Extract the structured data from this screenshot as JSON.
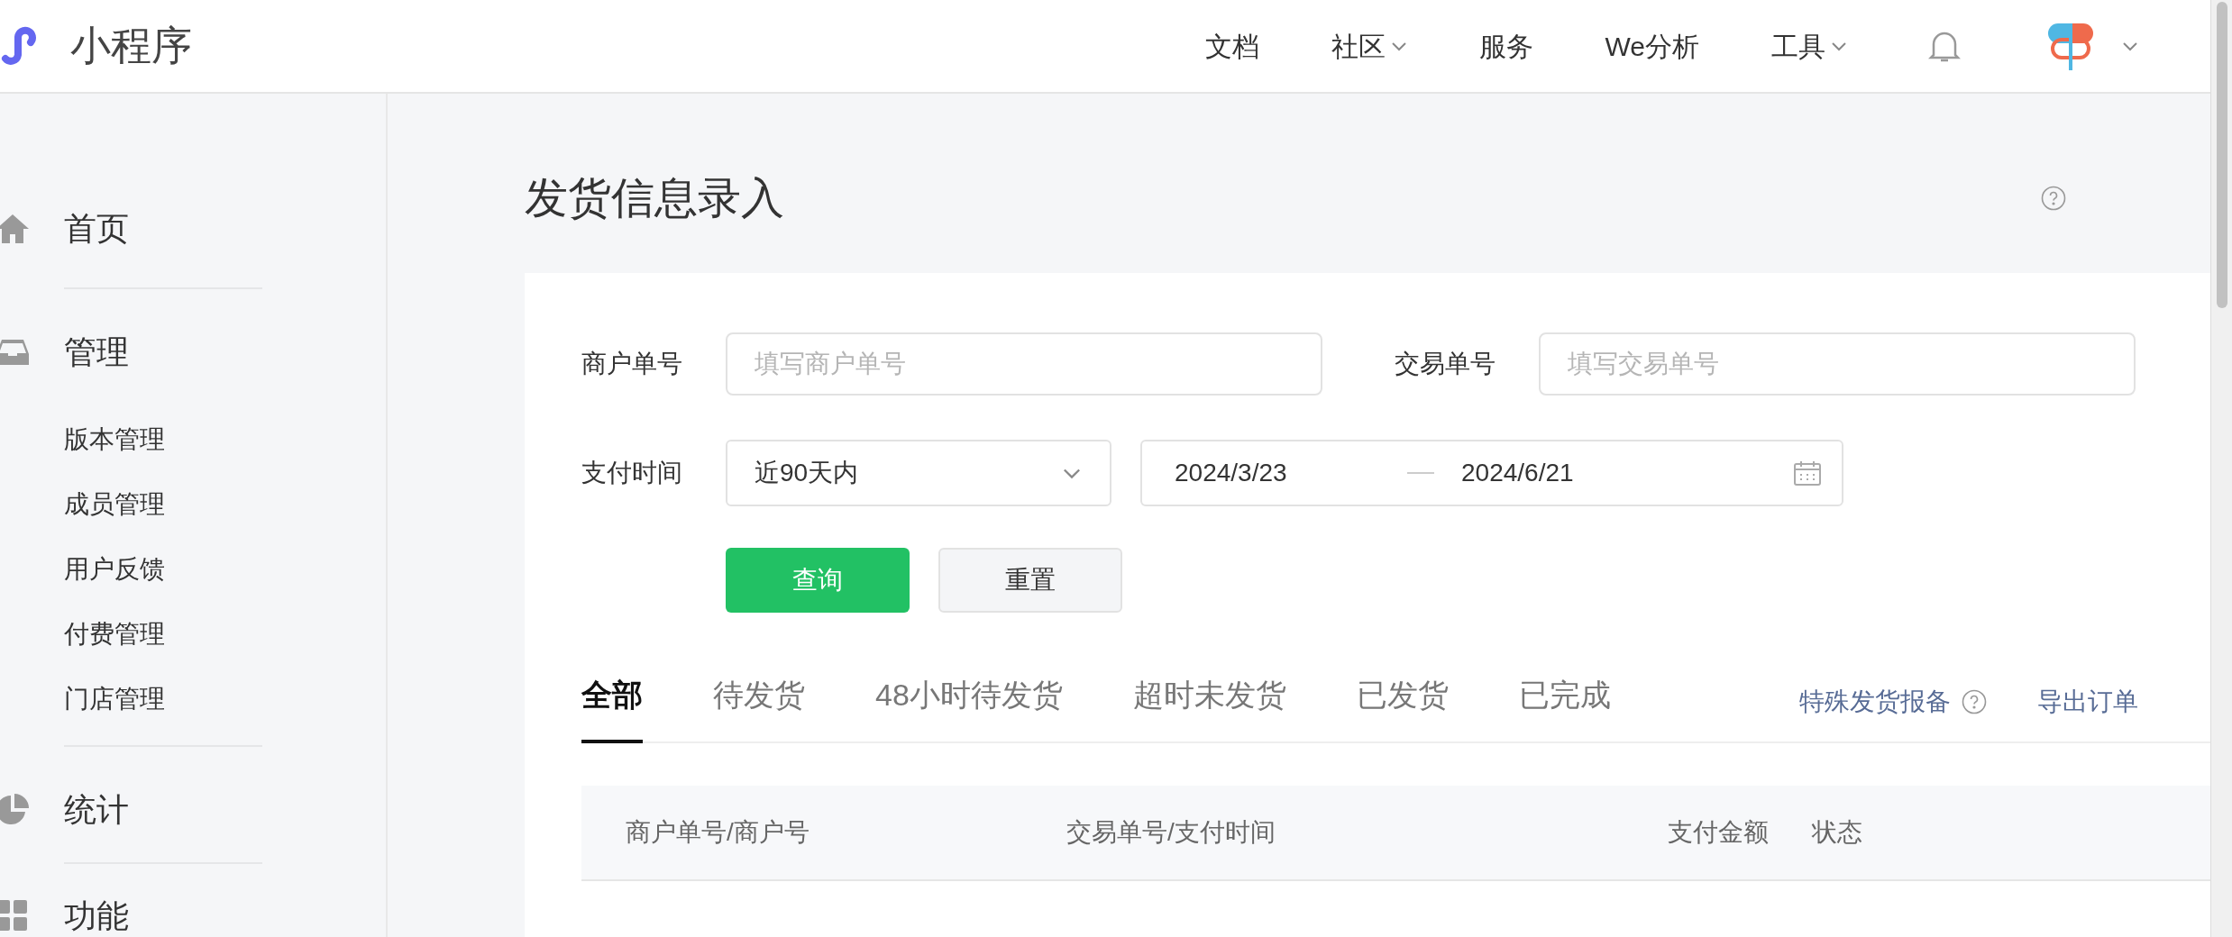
{
  "header": {
    "logo_text": "小程序",
    "nav": [
      {
        "label": "文档",
        "dropdown": false
      },
      {
        "label": "社区",
        "dropdown": true
      },
      {
        "label": "服务",
        "dropdown": false
      },
      {
        "label": "We分析",
        "dropdown": false
      },
      {
        "label": "工具",
        "dropdown": true
      }
    ]
  },
  "sidebar": {
    "groups": [
      {
        "label": "首页"
      },
      {
        "label": "管理",
        "children": [
          {
            "label": "版本管理"
          },
          {
            "label": "成员管理"
          },
          {
            "label": "用户反馈"
          },
          {
            "label": "付费管理"
          },
          {
            "label": "门店管理"
          }
        ]
      },
      {
        "label": "统计"
      },
      {
        "label": "功能"
      }
    ]
  },
  "page": {
    "title": "发货信息录入"
  },
  "filters": {
    "merchant_no": {
      "label": "商户单号",
      "placeholder": "填写商户单号"
    },
    "trade_no": {
      "label": "交易单号",
      "placeholder": "填写交易单号"
    },
    "pay_time": {
      "label": "支付时间",
      "range": "近90天内",
      "start": "2024/3/23",
      "end": "2024/6/21"
    },
    "buttons": [
      {
        "label": "查询",
        "kind": "primary"
      },
      {
        "label": "重置",
        "kind": "default"
      }
    ]
  },
  "tabs": [
    {
      "label": "全部",
      "selected": true
    },
    {
      "label": "待发货",
      "selected": false
    },
    {
      "label": "48小时待发货",
      "selected": false
    },
    {
      "label": "超时未发货",
      "selected": false
    },
    {
      "label": "已发货",
      "selected": false
    },
    {
      "label": "已完成",
      "selected": false
    }
  ],
  "links": [
    {
      "label": "特殊发货报备",
      "help": true
    },
    {
      "label": "导出订单",
      "help": false
    }
  ],
  "table": {
    "columns": [
      "商户单号/商户号",
      "交易单号/支付时间",
      "支付金额",
      "状态"
    ]
  }
}
